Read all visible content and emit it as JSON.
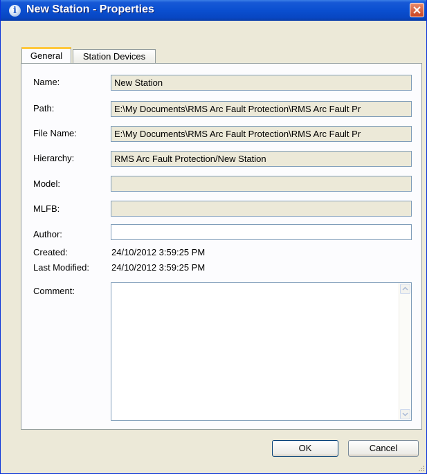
{
  "window": {
    "title": "New Station - Properties",
    "info_icon": "i"
  },
  "tabs": [
    {
      "label": "General"
    },
    {
      "label": "Station Devices"
    }
  ],
  "fields": {
    "name": {
      "label": "Name:",
      "value": "New Station"
    },
    "path": {
      "label": "Path:",
      "value": "E:\\My Documents\\RMS Arc Fault Protection\\RMS Arc Fault Pr"
    },
    "file_name": {
      "label": "File Name:",
      "value": "E:\\My Documents\\RMS Arc Fault Protection\\RMS Arc Fault Pr"
    },
    "hierarchy": {
      "label": "Hierarchy:",
      "value": "RMS Arc Fault Protection/New Station"
    },
    "model": {
      "label": "Model:",
      "value": ""
    },
    "mlfb": {
      "label": "MLFB:",
      "value": ""
    },
    "author": {
      "label": "Author:",
      "value": ""
    },
    "created": {
      "label": "Created:",
      "value": "24/10/2012 3:59:25 PM"
    },
    "last_modified": {
      "label": "Last Modified:",
      "value": "24/10/2012 3:59:25 PM"
    },
    "comment": {
      "label": "Comment:",
      "value": ""
    }
  },
  "buttons": {
    "ok": "OK",
    "cancel": "Cancel"
  },
  "icons": [
    "info-icon",
    "close-icon",
    "scroll-up-icon",
    "scroll-down-icon",
    "resize-grip-icon"
  ],
  "colors": {
    "titlebar": "#0a4fd0",
    "dialog_bg": "#ece9d8",
    "tab_highlight": "#ffc83c"
  }
}
